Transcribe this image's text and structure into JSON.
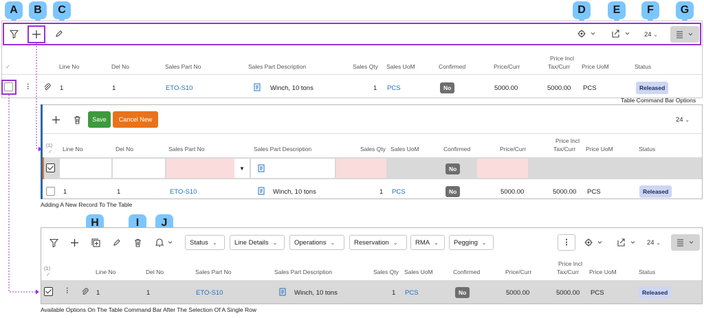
{
  "callouts": [
    "A",
    "B",
    "C",
    "D",
    "E",
    "F",
    "G",
    "H",
    "I",
    "J"
  ],
  "toolbar": {
    "page_size": "24",
    "filter_icon": "filter-icon",
    "add_icon": "plus-icon",
    "edit_icon": "pencil-icon",
    "settings_icon": "gear-icon",
    "export_icon": "export-icon",
    "layout_icon": "list-layout-icon"
  },
  "table1": {
    "headers": [
      "Line No",
      "Del No",
      "Sales Part No",
      "Sales Part Description",
      "Sales Qty",
      "Sales UoM",
      "Confirmed",
      "Price/Curr",
      "Price Incl",
      "Tax/Curr",
      "Price UoM",
      "Status"
    ],
    "row": {
      "line_no": "1",
      "del_no": "1",
      "sales_part_no": "ETO-S10",
      "description": "Winch, 10 tons",
      "qty": "1",
      "uom": "PCS",
      "confirmed": "No",
      "price": "5000.00",
      "price_incl": "5000.00",
      "price_uom": "PCS",
      "status": "Released"
    }
  },
  "caption1": "Table Command Bar Options",
  "panel2": {
    "save_label": "Save",
    "cancel_label": "Cancel New",
    "page_size": "24",
    "count": "(1)",
    "headers": [
      "Line No",
      "Del No",
      "Sales Part No",
      "Sales Part Description",
      "Sales Qty",
      "Sales UoM",
      "Confirmed",
      "Price/Curr",
      "Price Incl",
      "Tax/Curr",
      "Price UoM",
      "Status"
    ],
    "new_row_confirmed": "No",
    "row": {
      "line_no": "1",
      "del_no": "1",
      "sales_part_no": "ETO-S10",
      "description": "Winch, 10 tons",
      "qty": "1",
      "uom": "PCS",
      "confirmed": "No",
      "price": "5000.00",
      "price_incl": "5000.00",
      "price_uom": "PCS",
      "status": "Released"
    }
  },
  "caption2": "Adding A New Record To The Table",
  "panel3": {
    "dropdowns": [
      "Status",
      "Line Details",
      "Operations",
      "Reservation",
      "RMA",
      "Pegging"
    ],
    "page_size": "24",
    "count": "(1)",
    "headers": [
      "Line No",
      "Del No",
      "Sales Part No",
      "Sales Part Description",
      "Sales Qty",
      "Sales UoM",
      "Confirmed",
      "Price/Curr",
      "Price Incl",
      "Tax/Curr",
      "Price UoM",
      "Status"
    ],
    "row": {
      "line_no": "1",
      "del_no": "1",
      "sales_part_no": "ETO-S10",
      "description": "Winch, 10 tons",
      "qty": "1",
      "uom": "PCS",
      "confirmed": "No",
      "price": "5000.00",
      "price_incl": "5000.00",
      "price_uom": "PCS",
      "status": "Released"
    }
  },
  "caption3": "Available Options On The Table Command Bar After The Selection Of A Single Row",
  "colors": {
    "highlight": "#9b30d9",
    "callout": "#7cc6ff",
    "save": "#3c9a3c",
    "cancel": "#e8731a",
    "link": "#1f6fbf"
  }
}
